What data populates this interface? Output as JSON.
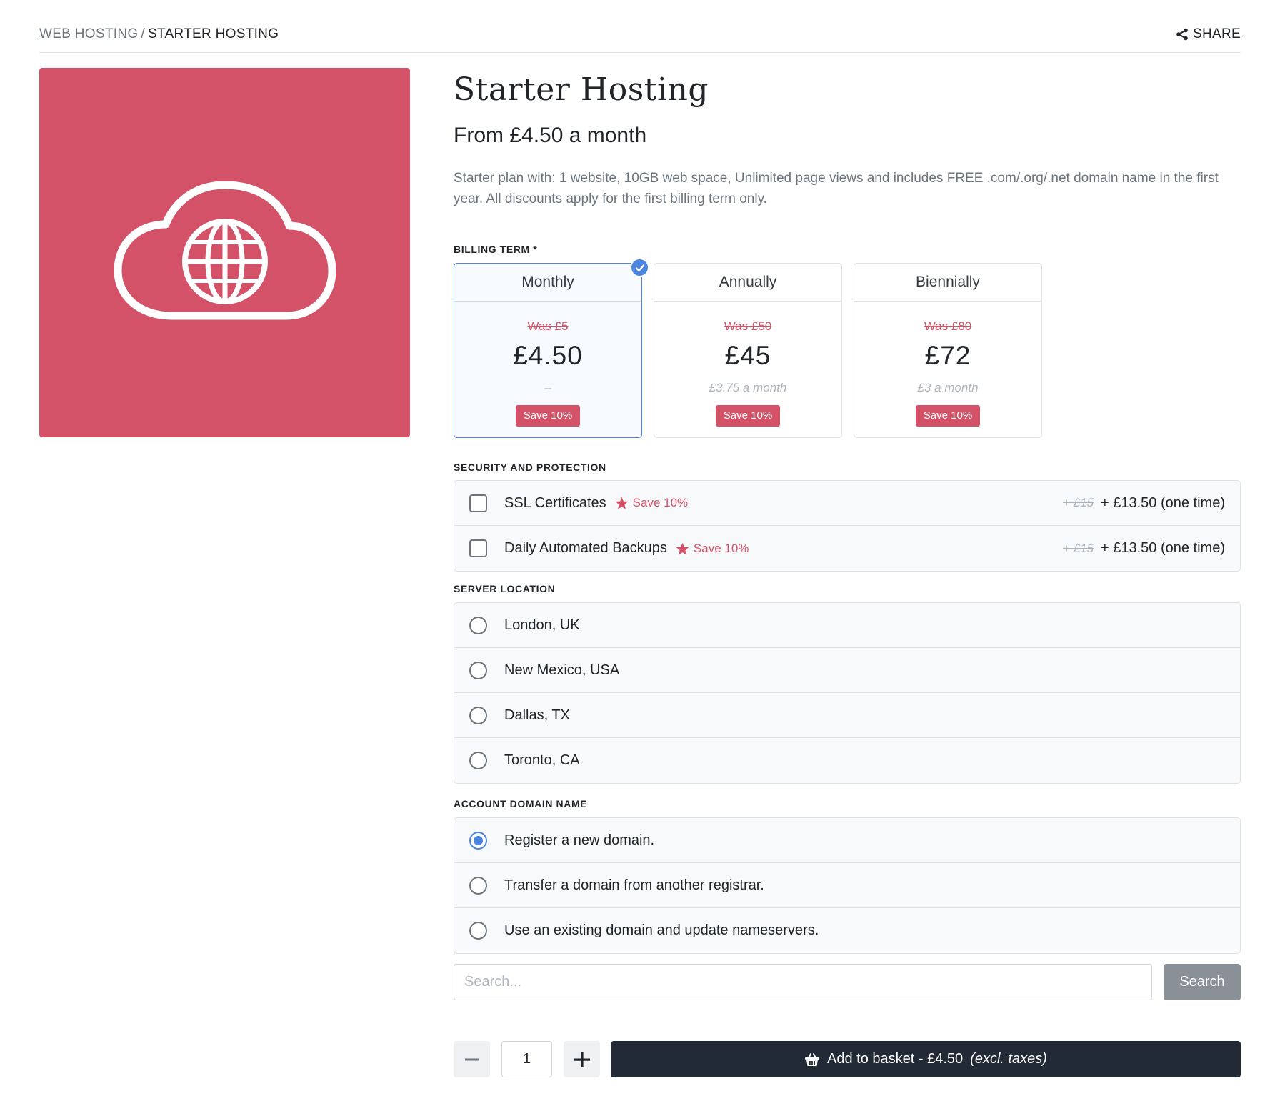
{
  "breadcrumb": {
    "parent": "WEB HOSTING",
    "separator": "/",
    "current": "STARTER HOSTING"
  },
  "share": {
    "label": "SHARE"
  },
  "product": {
    "image_icon": "cloud-globe-icon",
    "image_bg_color": "#d45268",
    "title": "Starter Hosting",
    "price_from": "From £4.50 a month",
    "description": "Starter plan with: 1 website, 10GB web space, Unlimited page views and includes FREE .com/.org/.net domain name in the first year. All discounts apply for the first billing term only."
  },
  "billing": {
    "label": "BILLING TERM *",
    "selected": "Monthly",
    "terms": [
      {
        "name": "Monthly",
        "was": "Was £5",
        "price": "£4.50",
        "per": "–",
        "save": "Save 10%"
      },
      {
        "name": "Annually",
        "was": "Was £50",
        "price": "£45",
        "per": "£3.75 a month",
        "save": "Save 10%"
      },
      {
        "name": "Biennially",
        "was": "Was £80",
        "price": "£72",
        "per": "£3 a month",
        "save": "Save 10%"
      }
    ]
  },
  "security": {
    "label": "SECURITY AND PROTECTION",
    "options": [
      {
        "name": "SSL Certificates",
        "promo": "Save 10%",
        "old_price": "+ £15",
        "price": "+ £13.50 (one time)",
        "checked": false
      },
      {
        "name": "Daily Automated Backups",
        "promo": "Save 10%",
        "old_price": "+ £15",
        "price": "+ £13.50 (one time)",
        "checked": false
      }
    ]
  },
  "server": {
    "label": "SERVER LOCATION",
    "options": [
      "London, UK",
      "New Mexico, USA",
      "Dallas, TX",
      "Toronto, CA"
    ]
  },
  "domain": {
    "label": "ACCOUNT DOMAIN NAME",
    "selected": "Register a new domain.",
    "options": [
      "Register a new domain.",
      "Transfer a domain from another registrar.",
      "Use an existing domain and update nameservers."
    ]
  },
  "search": {
    "placeholder": "Search...",
    "button": "Search"
  },
  "quantity": {
    "value": "1"
  },
  "basket": {
    "label": "Add to basket - £4.50",
    "note": "(excl. taxes)"
  },
  "colors": {
    "accent": "#d45268",
    "selected": "#4a86e0",
    "basket": "#212a35"
  }
}
